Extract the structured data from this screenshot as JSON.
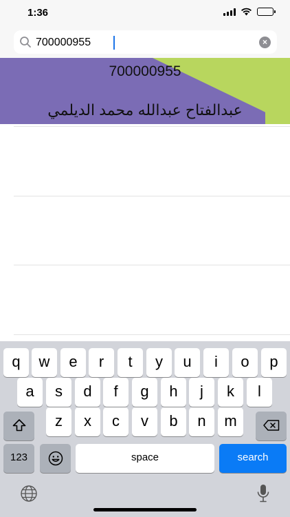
{
  "status_bar": {
    "time": "1:36"
  },
  "search": {
    "value": "700000955",
    "placeholder": ""
  },
  "result": {
    "number": "700000955",
    "name": "عبدالفتاح عبدالله محمد الديلمي"
  },
  "colors": {
    "card_purple": "#7b6cb5",
    "card_green": "#b8d65e",
    "search_key_blue": "#0a7bf6"
  },
  "keyboard": {
    "row1": [
      "q",
      "w",
      "e",
      "r",
      "t",
      "y",
      "u",
      "i",
      "o",
      "p"
    ],
    "row2": [
      "a",
      "s",
      "d",
      "f",
      "g",
      "h",
      "j",
      "k",
      "l"
    ],
    "row3": [
      "z",
      "x",
      "c",
      "v",
      "b",
      "n",
      "m"
    ],
    "numbers_label": "123",
    "space_label": "space",
    "search_label": "search",
    "emoji_icon": "emoji-icon",
    "globe_icon": "globe-icon",
    "mic_icon": "microphone-icon"
  }
}
